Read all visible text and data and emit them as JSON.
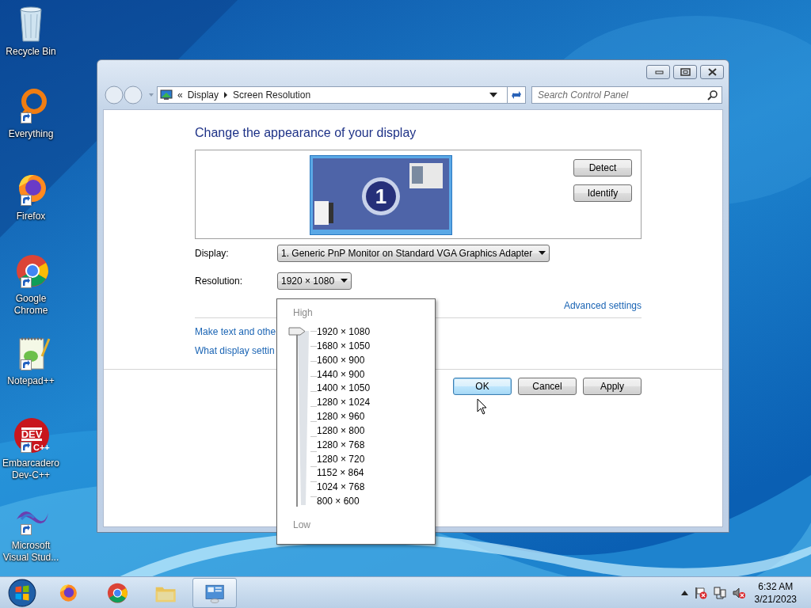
{
  "desktop_icons": [
    {
      "kind": "recycle-bin",
      "label": "Recycle Bin",
      "shortcut": false
    },
    {
      "kind": "everything",
      "label": "Everything",
      "shortcut": true
    },
    {
      "kind": "firefox",
      "label": "Firefox",
      "shortcut": true
    },
    {
      "kind": "chrome",
      "label": "Google Chrome",
      "shortcut": true
    },
    {
      "kind": "notepad",
      "label": "Notepad++",
      "shortcut": true
    },
    {
      "kind": "devcpp",
      "label": "Embarcadero Dev-C++",
      "shortcut": true,
      "logo_text": "DEV",
      "logo_sub": "C++"
    },
    {
      "kind": "visual-studio",
      "label": "Microsoft Visual Stud...",
      "shortcut": true
    }
  ],
  "window": {
    "address_bar": {
      "overflow": "«",
      "breadcrumbs": [
        "Display",
        "Screen Resolution"
      ],
      "search_placeholder": "Search Control Panel"
    },
    "heading": "Change the appearance of your display",
    "preview": {
      "monitor_number": "1",
      "buttons": [
        "Detect",
        "Identify"
      ]
    },
    "fields": [
      {
        "label": "Display:",
        "value": "1. Generic PnP Monitor on Standard VGA Graphics Adapter"
      },
      {
        "label": "Resolution:",
        "value": "1920 × 1080"
      }
    ],
    "advanced_link": "Advanced settings",
    "links": [
      "Make text and othe",
      "What display settin"
    ],
    "buttons": [
      {
        "label": "OK",
        "default": true
      },
      {
        "label": "Cancel",
        "default": false
      },
      {
        "label": "Apply",
        "default": false
      }
    ]
  },
  "resolution_popup": {
    "high_label": "High",
    "low_label": "Low",
    "options": [
      "1920 × 1080",
      "1680 × 1050",
      "1600 × 900",
      "1440 × 900",
      "1400 × 1050",
      "1280 × 1024",
      "1280 × 960",
      "1280 × 800",
      "1280 × 768",
      "1280 × 720",
      "1152 × 864",
      "1024 × 768",
      "800 × 600"
    ]
  },
  "taskbar": {
    "items": [
      {
        "kind": "firefox",
        "active": false
      },
      {
        "kind": "chrome",
        "active": false
      },
      {
        "kind": "folder",
        "active": false
      },
      {
        "kind": "control-panel",
        "active": true
      }
    ],
    "time": "6:32 AM",
    "date": "3/21/2023"
  }
}
